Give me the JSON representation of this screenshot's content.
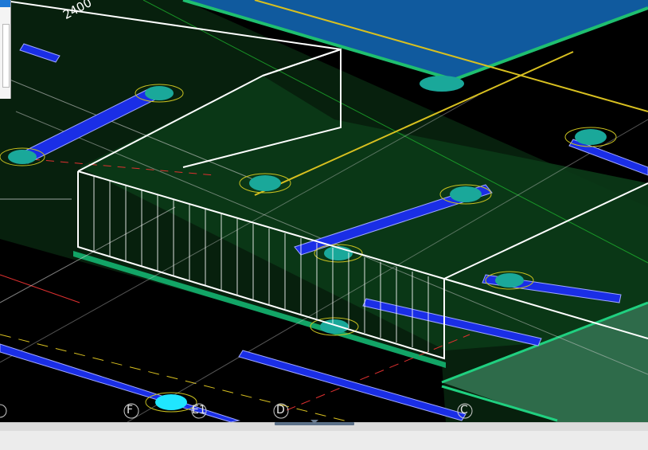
{
  "dimension_label": "2400",
  "grid_axes": [
    {
      "id": "F",
      "label": "F"
    },
    {
      "id": "E1",
      "label": "E1"
    },
    {
      "id": "D",
      "label": "D"
    },
    {
      "id": "C",
      "label": "C"
    }
  ],
  "colors": {
    "background": "#000000",
    "slab_fill": "#0a3a12",
    "slab_edge": "#17c07a",
    "beam_blue": "#1a2ee6",
    "column_cyan": "#1aa89a",
    "selection_box": "#ffffff",
    "top_panel": "#1560a8",
    "axis_red": "#e03030",
    "axis_yellow": "#d8c020"
  },
  "icons": [
    "column-marker-icon",
    "grid-axis-bubble-icon",
    "scroll-arrow-icon"
  ]
}
